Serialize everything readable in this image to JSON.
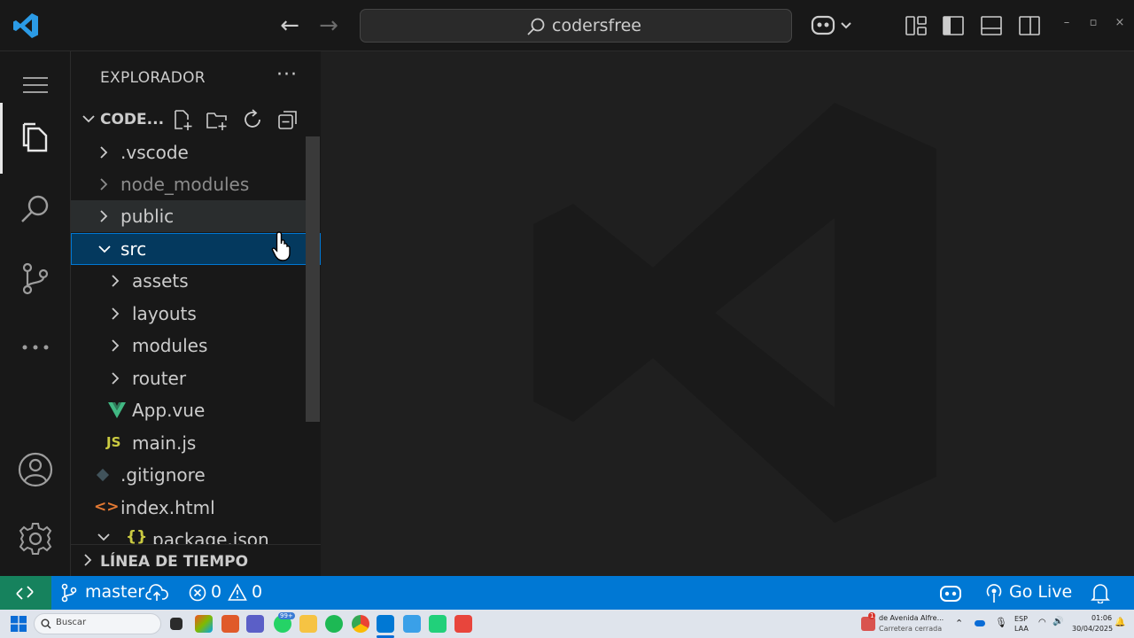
{
  "titlebar": {
    "search_text": "codersfree"
  },
  "sidebar": {
    "title": "EXPLORADOR",
    "more": "···",
    "project_name": "CODE...",
    "tree": [
      {
        "label": ".vscode",
        "type": "folder",
        "expanded": false,
        "level": 0
      },
      {
        "label": "node_modules",
        "type": "folder",
        "expanded": false,
        "level": 0,
        "dimmed": true
      },
      {
        "label": "public",
        "type": "folder",
        "expanded": false,
        "level": 0
      },
      {
        "label": "src",
        "type": "folder",
        "expanded": true,
        "level": 0,
        "selected": true
      },
      {
        "label": "assets",
        "type": "folder",
        "expanded": false,
        "level": 1
      },
      {
        "label": "layouts",
        "type": "folder",
        "expanded": false,
        "level": 1
      },
      {
        "label": "modules",
        "type": "folder",
        "expanded": false,
        "level": 1
      },
      {
        "label": "router",
        "type": "folder",
        "expanded": false,
        "level": 1
      },
      {
        "label": "App.vue",
        "type": "vue",
        "level": 1
      },
      {
        "label": "main.js",
        "type": "js",
        "icon_text": "JS",
        "level": 1
      },
      {
        "label": ".gitignore",
        "type": "git",
        "level": 0
      },
      {
        "label": "index.html",
        "type": "html",
        "icon_text": "<>",
        "level": 0
      },
      {
        "label": "package.json",
        "type": "json",
        "icon_text": "{}",
        "level": 0
      }
    ],
    "timeline_label": "LÍNEA DE TIEMPO"
  },
  "statusbar": {
    "branch": "master",
    "errors": "0",
    "warnings": "0",
    "go_live": "Go Live"
  },
  "taskbar": {
    "search_placeholder": "Buscar",
    "notif_badge": "99+",
    "weather_badge": "1",
    "news_title": "de Avenida Alfre...",
    "news_sub": "Carretera cerrada",
    "lang": "ESP",
    "layout": "LAA",
    "time": "01:06",
    "date": "30/04/2025"
  },
  "colors": {
    "accent": "#0078d4",
    "remote": "#16825d",
    "vue": "#41b883",
    "js": "#cbcb41",
    "html": "#e37933",
    "selection": "#04395e"
  }
}
